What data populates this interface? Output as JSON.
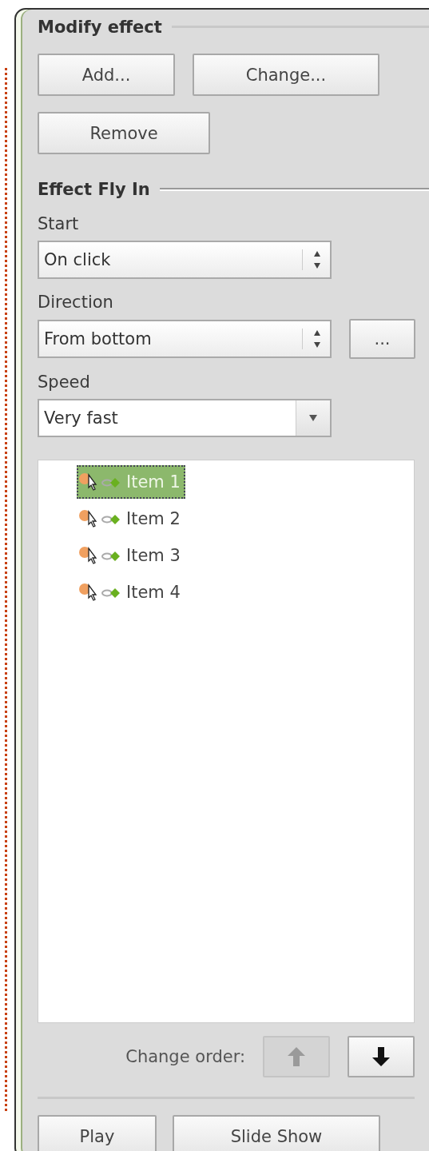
{
  "modify_effect": {
    "title": "Modify effect",
    "buttons": [
      {
        "label": "Add..."
      },
      {
        "label": "Change..."
      },
      {
        "label": "Remove"
      }
    ]
  },
  "effect": {
    "title": "Effect Fly In",
    "fields": [
      {
        "label": "Start",
        "kind": "spin",
        "value": "On click"
      },
      {
        "label": "Direction",
        "kind": "spin",
        "value": "From bottom",
        "extra_button": "..."
      },
      {
        "label": "Speed",
        "kind": "dropdown",
        "value": "Very fast"
      }
    ]
  },
  "items": [
    {
      "label": "Item 1",
      "selected": true
    },
    {
      "label": "Item 2",
      "selected": false
    },
    {
      "label": "Item 3",
      "selected": false
    },
    {
      "label": "Item 4",
      "selected": false
    }
  ],
  "change_order": {
    "label": "Change order:",
    "up_disabled": true,
    "down_disabled": false
  },
  "footer_buttons": [
    {
      "label": "Play"
    },
    {
      "label": "Slide Show"
    }
  ]
}
